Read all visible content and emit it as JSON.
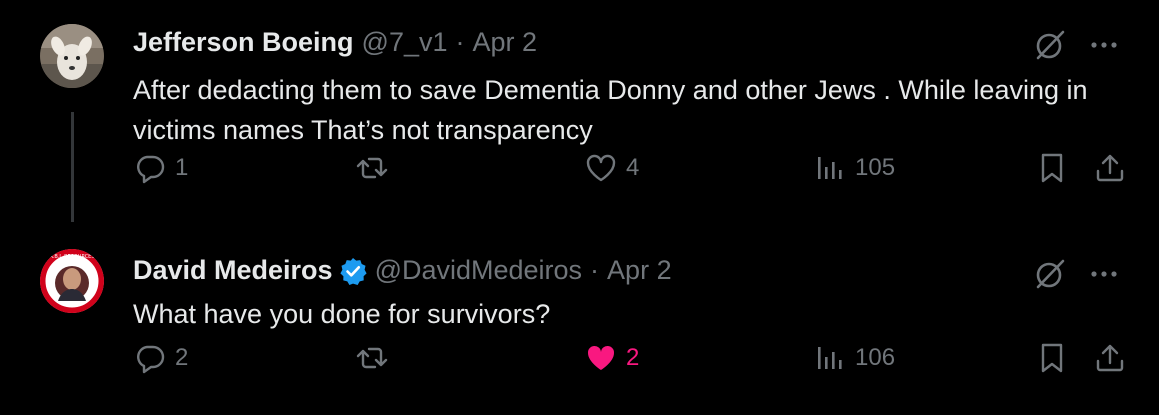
{
  "tweets": [
    {
      "author_name": "Jefferson Boeing",
      "handle": "@7_v1",
      "separator": "·",
      "date": "Apr 2",
      "verified": false,
      "text": "After dedacting them to save Dementia Donny and other Jews . While leaving in victims names That’s not transparency",
      "replies": "1",
      "retweets": "",
      "likes": "4",
      "views": "105",
      "liked": false
    },
    {
      "author_name": "David Medeiros",
      "handle": "@DavidMedeiros",
      "separator": "·",
      "date": "Apr 2",
      "verified": true,
      "text": "What have you done for survivors?",
      "replies": "2",
      "retweets": "",
      "likes": "2",
      "views": "106",
      "liked": true
    }
  ],
  "colors": {
    "background": "#000000",
    "text_primary": "#e7e9ea",
    "text_secondary": "#71767b",
    "verified_blue": "#1d9bf0",
    "like_pink": "#f91880"
  },
  "avatar2_badge_text": "A.B.I. RESOURCES"
}
